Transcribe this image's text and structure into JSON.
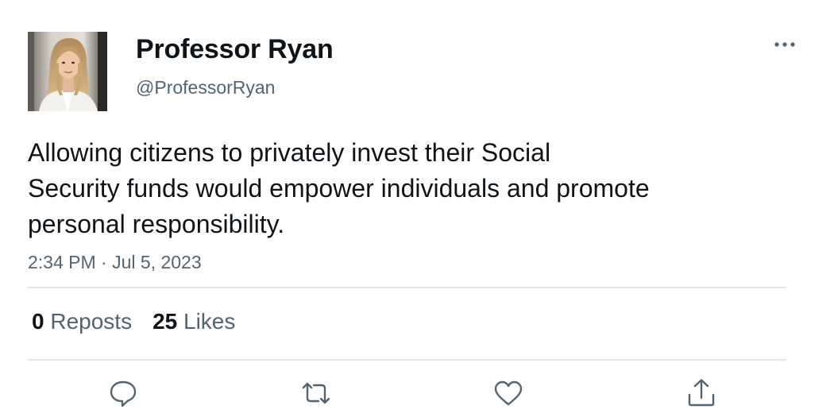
{
  "author": {
    "display_name": "Professor Ryan",
    "handle": "@ProfessorRyan",
    "avatar_icon": "profile-photo"
  },
  "tweet": {
    "text_lines": [
      "Allowing citizens to privately invest their Social",
      "Security funds would empower individuals and promote",
      "personal responsibility."
    ],
    "timestamp": "2:34 PM · Jul 5, 2023"
  },
  "stats": {
    "reposts_count": "0",
    "reposts_label": "Reposts",
    "likes_count": "25",
    "likes_label": "Likes"
  },
  "actions": [
    {
      "name": "reply",
      "icon": "speech-bubble-icon"
    },
    {
      "name": "repost",
      "icon": "repost-arrows-icon"
    },
    {
      "name": "like",
      "icon": "heart-icon"
    },
    {
      "name": "share",
      "icon": "share-upload-icon"
    }
  ],
  "colors": {
    "text_primary": "#0f1419",
    "text_secondary": "#536471",
    "divider": "#e1e6ea",
    "icon": "#536471"
  }
}
